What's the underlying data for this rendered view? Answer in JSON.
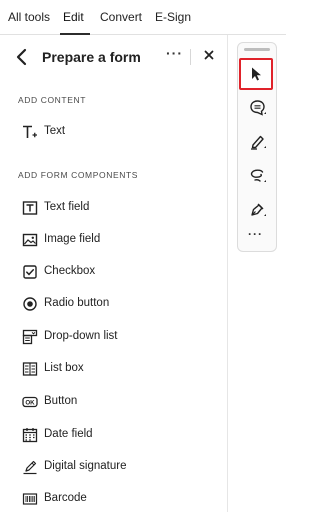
{
  "topnav": {
    "tabs": [
      {
        "label": "All tools"
      },
      {
        "label": "Edit"
      },
      {
        "label": "Convert"
      },
      {
        "label": "E-Sign"
      }
    ],
    "active": "Edit"
  },
  "panel": {
    "title": "Prepare a form",
    "more_label": "···",
    "sections": {
      "add_content": "ADD CONTENT",
      "add_components": "ADD FORM COMPONENTS"
    },
    "content_items": [
      {
        "label": "Text",
        "icon": "text-add-icon"
      }
    ],
    "component_items": [
      {
        "label": "Text field",
        "icon": "text-field-icon"
      },
      {
        "label": "Image field",
        "icon": "image-field-icon"
      },
      {
        "label": "Checkbox",
        "icon": "checkbox-icon"
      },
      {
        "label": "Radio button",
        "icon": "radio-button-icon"
      },
      {
        "label": "Drop-down list",
        "icon": "dropdown-list-icon"
      },
      {
        "label": "List box",
        "icon": "list-box-icon"
      },
      {
        "label": "Button",
        "icon": "ok-button-icon"
      },
      {
        "label": "Date field",
        "icon": "date-field-icon"
      },
      {
        "label": "Digital signature",
        "icon": "digital-signature-icon"
      },
      {
        "label": "Barcode",
        "icon": "barcode-icon"
      }
    ]
  },
  "toolrail": {
    "tools": [
      {
        "icon": "cursor-arrow-icon",
        "selected": true
      },
      {
        "icon": "comment-icon"
      },
      {
        "icon": "highlighter-icon"
      },
      {
        "icon": "draw-lasso-icon"
      },
      {
        "icon": "pen-tools-icon"
      }
    ],
    "more_label": "···"
  },
  "colors": {
    "selected_outline": "#e0222a",
    "active_underline": "#2c2c2c"
  }
}
